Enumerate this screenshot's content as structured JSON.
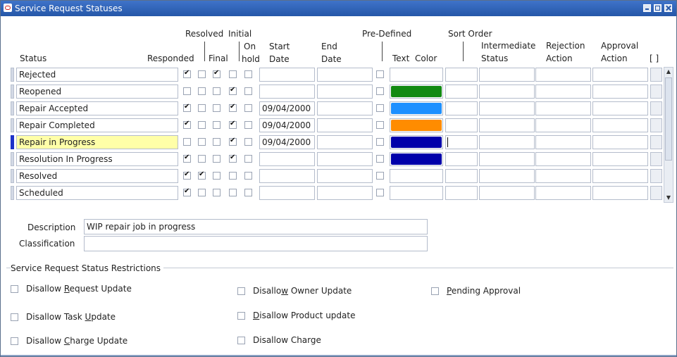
{
  "window": {
    "title": "Service Request Statuses"
  },
  "headers": {
    "status": "Status",
    "responded": "Responded",
    "resolved": "Resolved",
    "final": "Final",
    "initial": "Initial",
    "on": "On",
    "hold": "hold",
    "start": "Start",
    "start_date": "Date",
    "end": "End",
    "end_date": "Date",
    "predefined": "Pre-Defined",
    "text": "Text",
    "color": "Color",
    "sort_order": "Sort Order",
    "intermediate": "Intermediate",
    "intermediate_status": "Status",
    "rejection": "Rejection",
    "rejection_action": "Action",
    "approval": "Approval",
    "approval_action": "Action",
    "bracket": "[ ]"
  },
  "rows": [
    {
      "status": "Rejected",
      "responded": true,
      "resolved": false,
      "final": true,
      "initial": false,
      "on_hold": false,
      "start_date": "",
      "color": ""
    },
    {
      "status": "Reopened",
      "responded": false,
      "resolved": false,
      "final": false,
      "initial": true,
      "on_hold": false,
      "start_date": "",
      "color": "#128a12"
    },
    {
      "status": "Repair Accepted",
      "responded": true,
      "resolved": false,
      "final": false,
      "initial": true,
      "on_hold": false,
      "start_date": "09/04/2000",
      "color": "#1e90ff"
    },
    {
      "status": "Repair Completed",
      "responded": true,
      "resolved": false,
      "final": false,
      "initial": true,
      "on_hold": false,
      "start_date": "09/04/2000",
      "color": "#ff8c00"
    },
    {
      "status": "Repair in Progress",
      "responded": false,
      "resolved": false,
      "final": false,
      "initial": true,
      "on_hold": false,
      "start_date": "09/04/2000",
      "color": "#0000aa"
    },
    {
      "status": "Resolution In Progress",
      "responded": true,
      "resolved": false,
      "final": false,
      "initial": true,
      "on_hold": false,
      "start_date": "",
      "color": "#0000aa"
    },
    {
      "status": "Resolved",
      "responded": true,
      "resolved": true,
      "final": false,
      "initial": false,
      "on_hold": false,
      "start_date": "",
      "color": ""
    },
    {
      "status": "Scheduled",
      "responded": true,
      "resolved": false,
      "final": false,
      "initial": false,
      "on_hold": false,
      "start_date": "",
      "color": ""
    }
  ],
  "current_row": 4,
  "details": {
    "description_label": "Description",
    "description_value": "WIP repair job in progress",
    "classification_label": "Classification",
    "classification_value": ""
  },
  "restrictions": {
    "title": "Service Request Status Restrictions",
    "items": [
      {
        "pre": "Disallow ",
        "u": "R",
        "post": "equest Update"
      },
      {
        "pre": "Disallo",
        "u": "w",
        "post": " Owner Update"
      },
      {
        "pre": "",
        "u": "P",
        "post": "ending Approval"
      },
      {
        "pre": "Disallow Task ",
        "u": "U",
        "post": "pdate"
      },
      {
        "pre": "",
        "u": "D",
        "post": "isallow Product update"
      },
      {
        "pre": "Disallow ",
        "u": "C",
        "post": "harge Update"
      },
      {
        "pre": "Disallow Charge",
        "u": "",
        "post": ""
      }
    ]
  }
}
